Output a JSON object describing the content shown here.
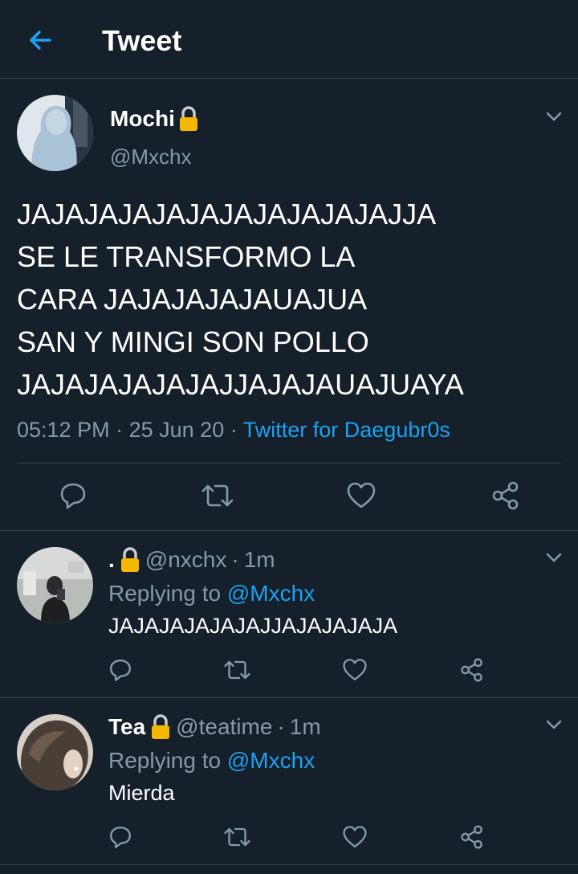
{
  "header": {
    "title": "Tweet"
  },
  "tweet": {
    "name": "Mochi",
    "handle": "@Mxchx",
    "lines": [
      "JAJAJAJAJAJAJAJAJAJAJAJJA",
      "SE LE TRANSFORMO LA",
      "CARA JAJAJAJAJAUAJUA",
      "SAN Y MINGI SON POLLO",
      "JAJAJAJAJAJAJJAJAJAUAJUAYA"
    ],
    "time": "05:12 PM",
    "date": "25 Jun 20",
    "source": "Twitter for Daegubr0s",
    "sep": "·"
  },
  "replies": [
    {
      "name": ".",
      "handle": "@nxchx",
      "time": "1m",
      "replying_label": "Replying to",
      "replying_to": "@Mxchx",
      "text": "JAJAJAJAJAJAJJAJAJAJAJA"
    },
    {
      "name": "Tea",
      "handle": "@teatime",
      "time": "1m",
      "replying_label": "Replying to",
      "replying_to": "@Mxchx",
      "text": "Mierda"
    }
  ],
  "colors": {
    "background": "#15202b",
    "accent": "#1da1f2",
    "secondary_text": "#8899a6",
    "divider": "#38444d",
    "lock": "#f5b800"
  },
  "icons": [
    "back-arrow-icon",
    "lock-icon",
    "chevron-down-icon",
    "reply-icon",
    "retweet-icon",
    "like-icon",
    "share-icon"
  ]
}
